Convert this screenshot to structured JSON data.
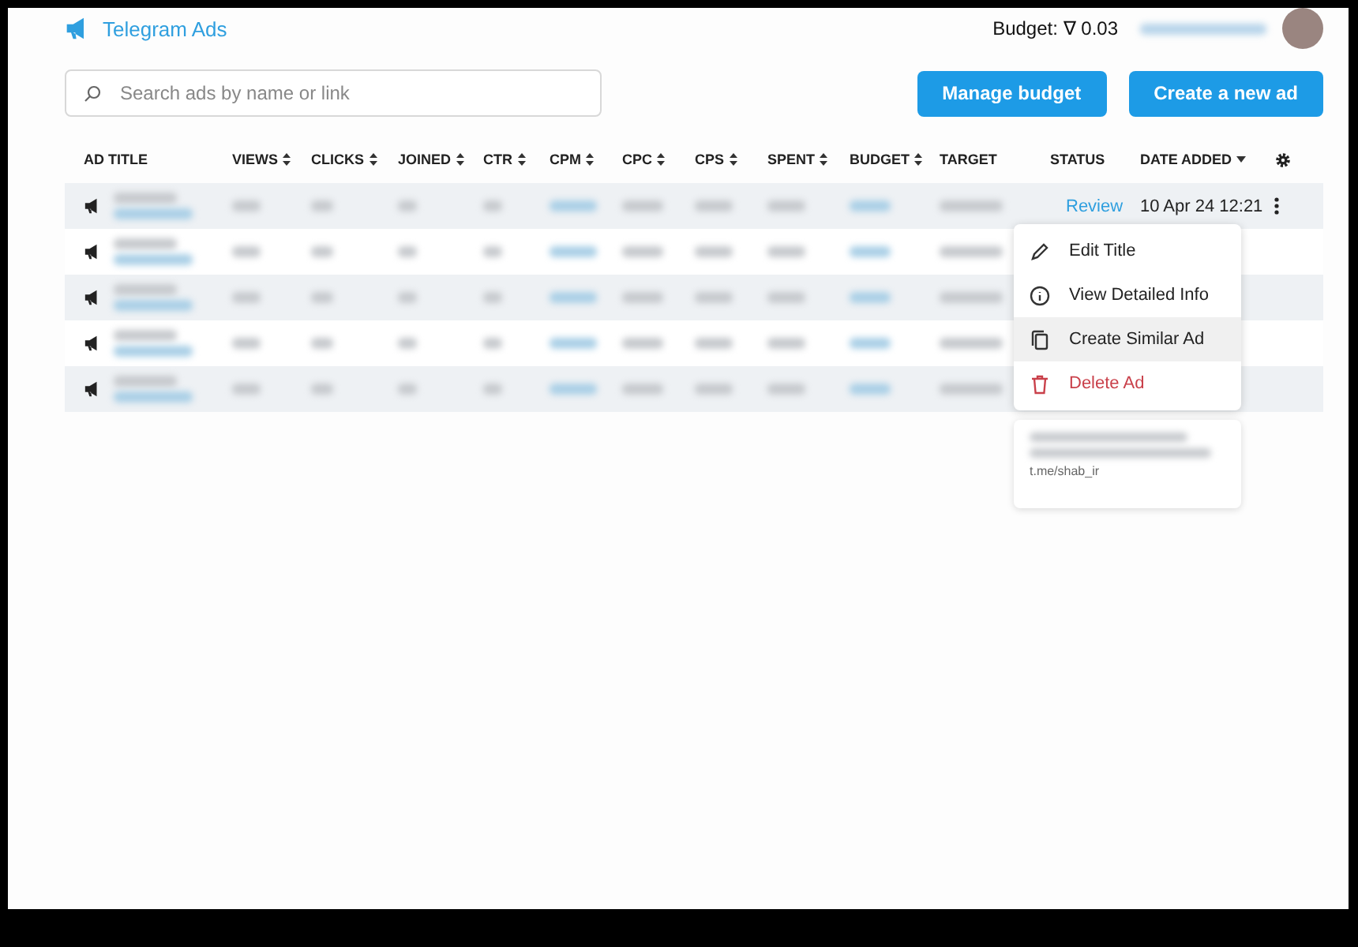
{
  "header": {
    "brand": "Telegram Ads",
    "budget_label": "Budget:",
    "budget_symbol": "∇",
    "budget_value": "0.03"
  },
  "search": {
    "placeholder": "Search ads by name or link"
  },
  "buttons": [
    "Manage budget",
    "Create a new ad"
  ],
  "table": {
    "columns": [
      {
        "label": "AD TITLE"
      },
      {
        "label": "VIEWS",
        "sortable": true,
        "link": false
      },
      {
        "label": "CLICKS",
        "sortable": true,
        "link": false
      },
      {
        "label": "JOINED",
        "sortable": true,
        "link": false
      },
      {
        "label": "CTR",
        "sortable": true,
        "link": false
      },
      {
        "label": "CPM",
        "sortable": true,
        "link": true
      },
      {
        "label": "CPC",
        "sortable": true,
        "link": false
      },
      {
        "label": "CPS",
        "sortable": true,
        "link": false
      },
      {
        "label": "SPENT",
        "sortable": true,
        "link": false
      },
      {
        "label": "BUDGET",
        "sortable": true,
        "link": true
      },
      {
        "label": "TARGET",
        "link": false
      },
      {
        "label": "STATUS"
      },
      {
        "label": "DATE ADDED",
        "sorted": true
      }
    ],
    "rows": [
      {
        "redacted": true,
        "status": "Review",
        "date_added": "10 Apr 24 12:21"
      },
      {
        "redacted": true
      },
      {
        "redacted": true
      },
      {
        "redacted": true
      },
      {
        "redacted": true
      }
    ]
  },
  "menu": {
    "items": [
      {
        "label": "Edit Title",
        "kind": "edit",
        "hovered": false,
        "danger": false
      },
      {
        "label": "View Detailed Info",
        "kind": "info",
        "hovered": false,
        "danger": false
      },
      {
        "label": "Create Similar Ad",
        "kind": "copy",
        "hovered": true,
        "danger": false
      },
      {
        "label": "Delete Ad",
        "kind": "delete",
        "hovered": false,
        "danger": true
      }
    ]
  },
  "preview": {
    "link": "t.me/shab_ir"
  }
}
